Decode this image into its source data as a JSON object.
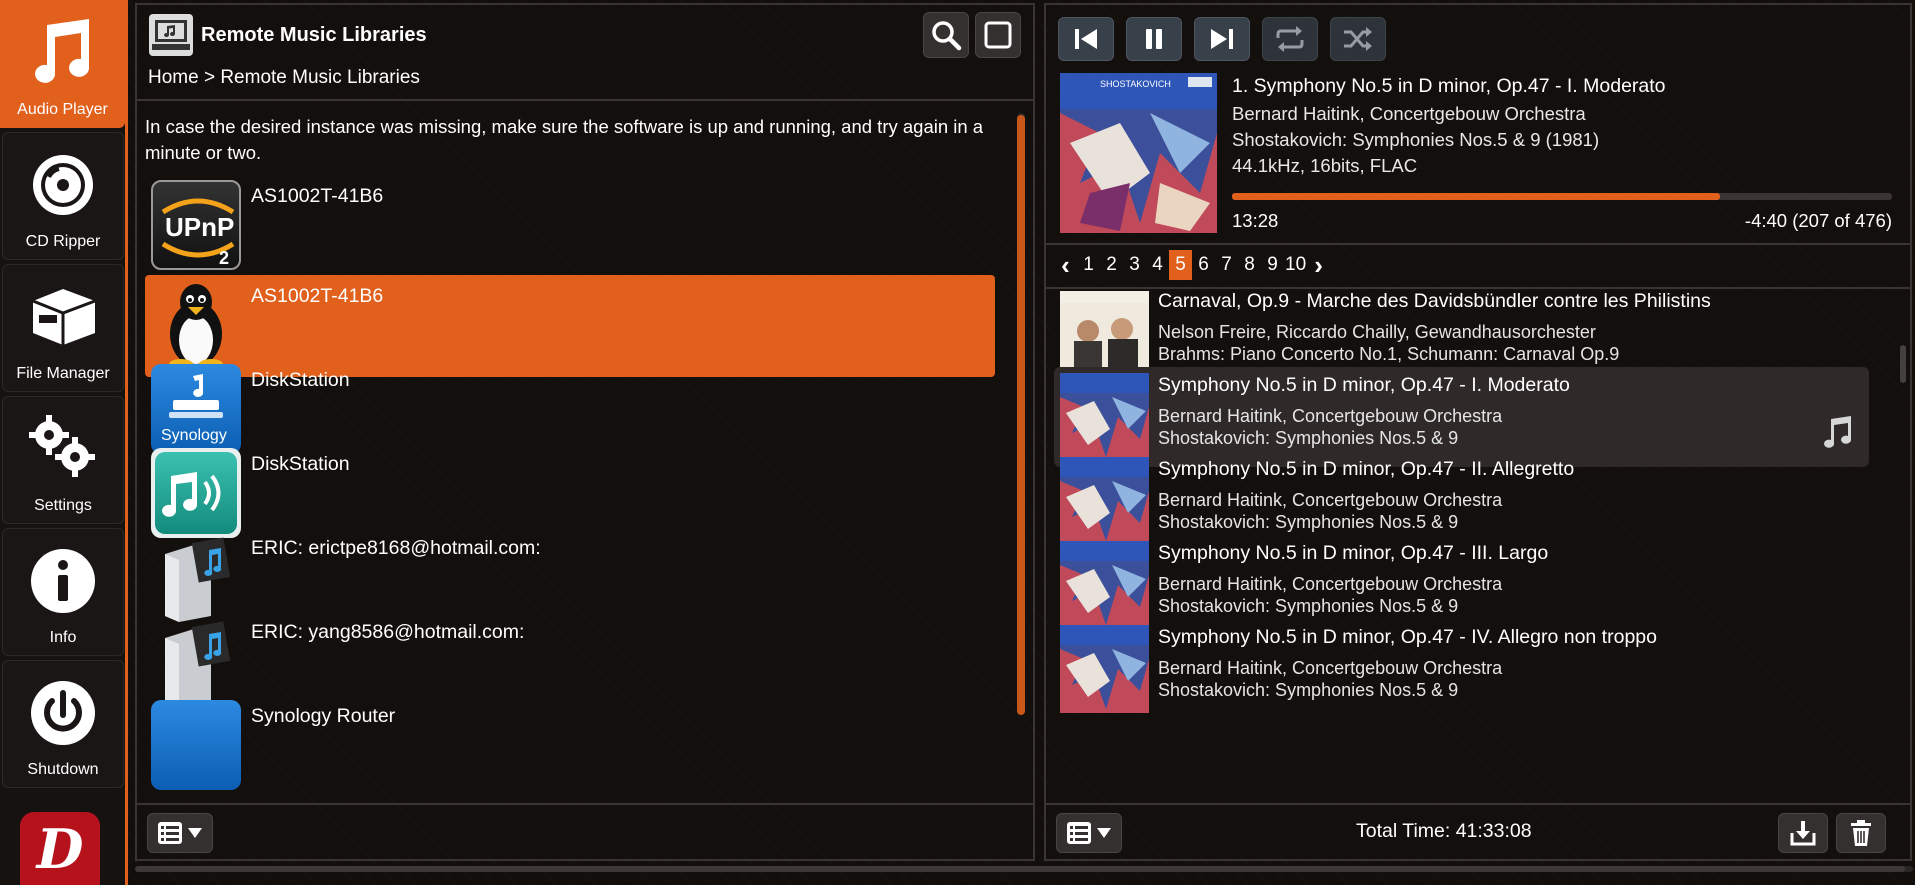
{
  "nav": {
    "items": [
      {
        "label": "Audio Player",
        "icon": "music-note-icon",
        "active": true
      },
      {
        "label": "CD Ripper",
        "icon": "cd-icon",
        "active": false
      },
      {
        "label": "File Manager",
        "icon": "box-icon",
        "active": false
      },
      {
        "label": "Settings",
        "icon": "gears-icon",
        "active": false
      },
      {
        "label": "Info",
        "icon": "info-icon",
        "active": false
      },
      {
        "label": "Shutdown",
        "icon": "power-icon",
        "active": false
      }
    ],
    "logo_letter": "D"
  },
  "library_panel": {
    "title": "Remote Music Libraries",
    "breadcrumb": "Home > Remote Music Libraries",
    "note": "In case the desired instance was missing, make sure the software is up and running, and try again in a minute or two.",
    "upnp_text": "UPnP",
    "upnp_num": "2",
    "synology_text": "Synology",
    "items": [
      {
        "name": "AS1002T-41B6",
        "icon": "upnp-icon",
        "selected": false
      },
      {
        "name": "AS1002T-41B6",
        "icon": "linux-penguin-icon",
        "selected": true
      },
      {
        "name": "DiskStation",
        "icon": "synology-icon",
        "selected": false
      },
      {
        "name": "DiskStation",
        "icon": "audio-station-icon",
        "selected": false
      },
      {
        "name": "ERIC: erictpe8168@hotmail.com:",
        "icon": "media-server-icon",
        "selected": false
      },
      {
        "name": "ERIC: yang8586@hotmail.com:",
        "icon": "media-server-icon",
        "selected": false
      },
      {
        "name": "Synology Router",
        "icon": "synology-icon",
        "selected": false
      }
    ]
  },
  "player": {
    "now_playing": {
      "title": "1. Symphony No.5 in D minor, Op.47 - I. Moderato",
      "artist": "Bernard Haitink, Concertgebouw Orchestra",
      "album": "Shostakovich: Symphonies Nos.5 & 9 (1981)",
      "format": "44.1kHz, 16bits, FLAC",
      "elapsed": "13:28",
      "remaining": "-4:40  (207 of 476)",
      "progress": 0.74,
      "art_caption": "SHOSTAKOVICH"
    },
    "pager": {
      "prev": "‹",
      "next": "›",
      "pages": [
        "1",
        "2",
        "3",
        "4",
        "5",
        "6",
        "7",
        "8",
        "9",
        "10"
      ],
      "current": "5"
    },
    "queue": [
      {
        "title": "Carnaval, Op.9 - Marche des Davidsbündler contre les Philistins",
        "artist": "Nelson Freire, Riccardo Chailly, Gewandhausorchester",
        "album": "Brahms: Piano Concerto No.1, Schumann: Carnaval Op.9",
        "playing": false,
        "art": "brahms"
      },
      {
        "title": "Symphony No.5 in D minor, Op.47 - I. Moderato",
        "artist": "Bernard Haitink, Concertgebouw Orchestra",
        "album": "Shostakovich: Symphonies Nos.5 & 9",
        "playing": true,
        "art": "shostakovich"
      },
      {
        "title": "Symphony No.5 in D minor, Op.47 - II. Allegretto",
        "artist": "Bernard Haitink, Concertgebouw Orchestra",
        "album": "Shostakovich: Symphonies Nos.5 & 9",
        "playing": false,
        "art": "shostakovich"
      },
      {
        "title": "Symphony No.5 in D minor, Op.47 - III. Largo",
        "artist": "Bernard Haitink, Concertgebouw Orchestra",
        "album": "Shostakovich: Symphonies Nos.5 & 9",
        "playing": false,
        "art": "shostakovich"
      },
      {
        "title": "Symphony No.5 in D minor, Op.47 - IV. Allegro non troppo",
        "artist": "Bernard Haitink, Concertgebouw Orchestra",
        "album": "Shostakovich: Symphonies Nos.5 & 9",
        "playing": false,
        "art": "shostakovich"
      }
    ],
    "total_time": "Total Time: 41:33:08"
  },
  "colors": {
    "accent": "#e0601c",
    "panel_border": "#3a3533",
    "background": "#120e0c"
  }
}
